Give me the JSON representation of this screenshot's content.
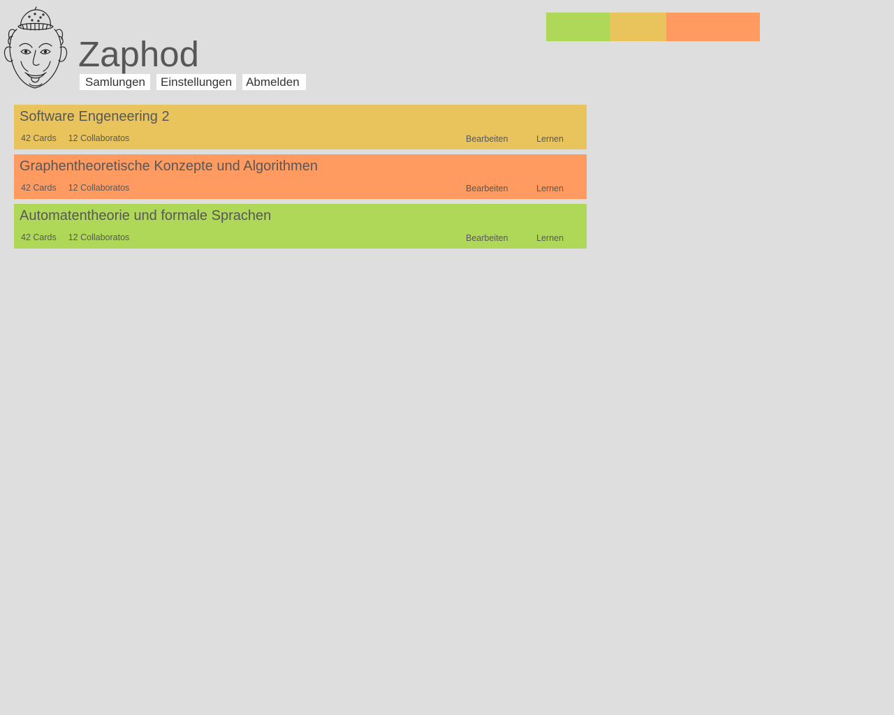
{
  "app": {
    "title": "Zaphod"
  },
  "nav": {
    "items": [
      {
        "label": "Samlungen"
      },
      {
        "label": "Einstellungen"
      },
      {
        "label": "Abmelden"
      }
    ]
  },
  "colors": {
    "background": "#dedede",
    "green": "#b0d858",
    "yellow": "#e9c45c",
    "orange": "#ff9b61",
    "text": "#575757",
    "nav_bg": "#ffffff"
  },
  "swatches": [
    "#b0d858",
    "#e9c45c",
    "#ff9b61"
  ],
  "collections": [
    {
      "title": "Software Engeneering 2",
      "cards": "42 Cards",
      "collaborators": "12 Collaboratos",
      "edit_label": "Bearbeiten",
      "learn_label": "Lernen",
      "color": "#e9c45c"
    },
    {
      "title": "Graphentheoretische Konzepte und Algorithmen",
      "cards": "42 Cards",
      "collaborators": "12 Collaboratos",
      "edit_label": "Bearbeiten",
      "learn_label": "Lernen",
      "color": "#ff9b61"
    },
    {
      "title": "Automatentheorie und formale Sprachen",
      "cards": "42 Cards",
      "collaborators": "12 Collaboratos",
      "edit_label": "Bearbeiten",
      "learn_label": "Lernen",
      "color": "#b0d858"
    }
  ]
}
